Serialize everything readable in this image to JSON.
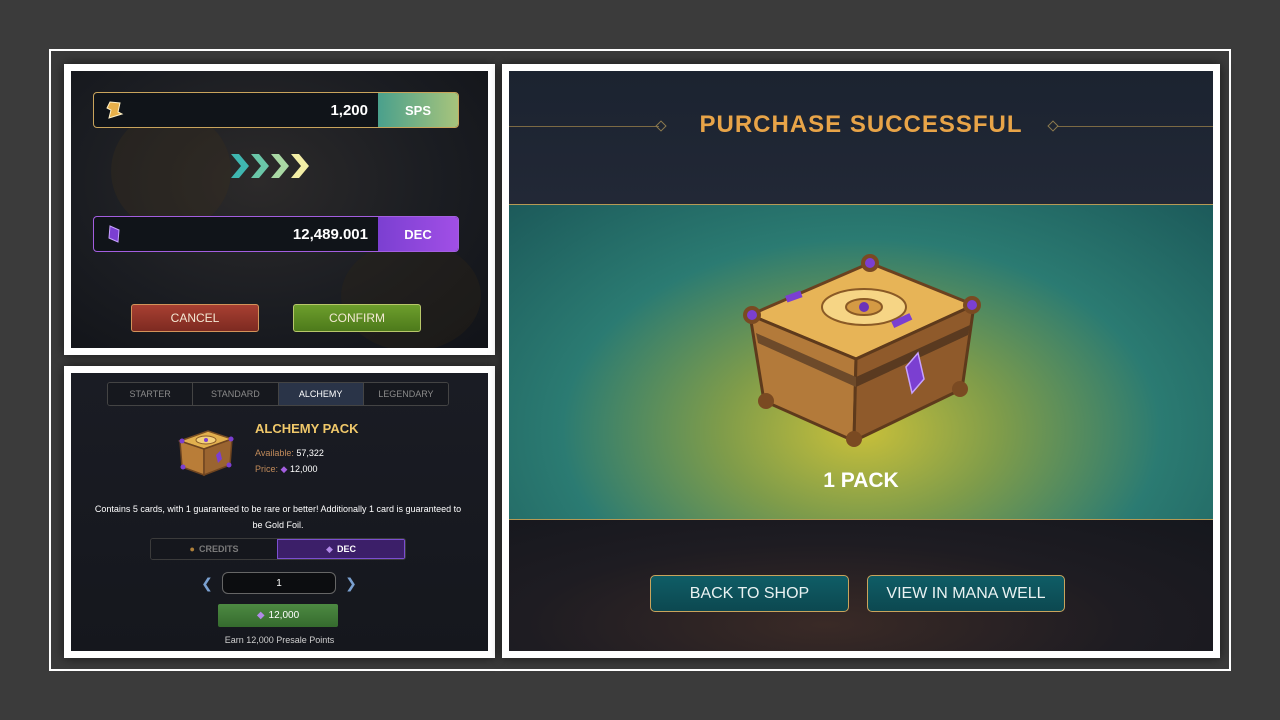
{
  "exchange": {
    "sps_amount": "1,200",
    "sps_label": "SPS",
    "dec_amount": "12,489.001",
    "dec_label": "DEC",
    "cancel_label": "CANCEL",
    "confirm_label": "CONFIRM"
  },
  "shop": {
    "tabs": [
      {
        "label": "STARTER",
        "active": false
      },
      {
        "label": "STANDARD",
        "active": false
      },
      {
        "label": "ALCHEMY",
        "active": true
      },
      {
        "label": "LEGENDARY",
        "active": false
      }
    ],
    "pack_title": "ALCHEMY PACK",
    "available_label": "Available:",
    "available_value": "57,322",
    "price_label": "Price:",
    "price_value": "12,000",
    "description": "Contains 5 cards, with 1 guaranteed to be rare or better! Additionally 1 card is guaranteed to be Gold Foil.",
    "currency_credits": "CREDITS",
    "currency_dec": "DEC",
    "quantity": "1",
    "buy_amount": "12,000",
    "earn_text": "Earn 12,000 Presale Points"
  },
  "success": {
    "title": "PURCHASE SUCCESSFUL",
    "pack_count": "1 PACK",
    "back_label": "BACK TO SHOP",
    "mana_label": "VIEW IN MANA WELL"
  },
  "colors": {
    "gold_title": "#e8a448",
    "sps_gradient": "#4aa08c",
    "dec_purple": "#7b3fd1",
    "teal_button": "#0f5d66"
  }
}
